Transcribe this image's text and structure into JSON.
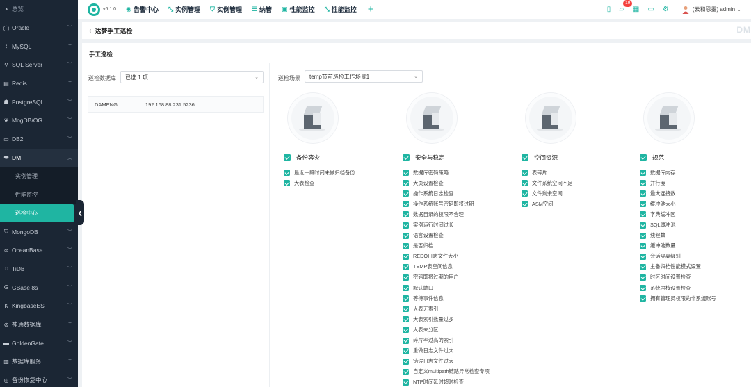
{
  "sidebar": {
    "items": [
      {
        "label": "总览",
        "icon": "overview-icon",
        "glyph": "◔"
      },
      {
        "label": "Oracle",
        "icon": "oracle-icon",
        "glyph": "◯"
      },
      {
        "label": "MySQL",
        "icon": "mysql-icon",
        "glyph": "⌇"
      },
      {
        "label": "SQL Server",
        "icon": "sqlserver-icon",
        "glyph": "⚲"
      },
      {
        "label": "Redis",
        "icon": "redis-icon",
        "glyph": "▤"
      },
      {
        "label": "PostgreSQL",
        "icon": "postgresql-icon",
        "glyph": "☗"
      },
      {
        "label": "MogDB/OG",
        "icon": "mogdb-icon",
        "glyph": "❦"
      },
      {
        "label": "DB2",
        "icon": "db2-icon",
        "glyph": "▭"
      },
      {
        "label": "DM",
        "icon": "dm-icon",
        "glyph": "⬬"
      }
    ],
    "dm_sub": [
      {
        "label": "实例管理"
      },
      {
        "label": "性能监控"
      },
      {
        "label": "巡检中心"
      }
    ],
    "items_after": [
      {
        "label": "MongoDB",
        "icon": "mongodb-icon",
        "glyph": "⛉"
      },
      {
        "label": "OceanBase",
        "icon": "oceanbase-icon",
        "glyph": "∞"
      },
      {
        "label": "TiDB",
        "icon": "tidb-icon",
        "glyph": "◌"
      },
      {
        "label": "GBase 8s",
        "icon": "gbase-icon",
        "glyph": "G"
      },
      {
        "label": "KingbaseES",
        "icon": "kingbase-icon",
        "glyph": "K"
      },
      {
        "label": "神通数据库",
        "icon": "shentong-icon",
        "glyph": "⊛"
      },
      {
        "label": "GoldenGate",
        "icon": "goldengate-icon",
        "glyph": "▬"
      },
      {
        "label": "数据库服务",
        "icon": "db-service-icon",
        "glyph": "▥"
      },
      {
        "label": "备份恢复中心",
        "icon": "backup-icon",
        "glyph": "◎"
      }
    ]
  },
  "topbar": {
    "version": "v6.1.0",
    "nav": [
      {
        "label": "告警中心",
        "icon": "alarm-icon",
        "glyph": "◉"
      },
      {
        "label": "实例管理",
        "icon": "instance-icon",
        "glyph": "⤡"
      },
      {
        "label": "实例管理",
        "icon": "instance-shield-icon",
        "glyph": "⛉"
      },
      {
        "label": "纳管",
        "icon": "manage-icon",
        "glyph": "☰"
      },
      {
        "label": "性能监控",
        "icon": "performance-icon",
        "glyph": "▣"
      },
      {
        "label": "性能监控",
        "icon": "performance-pin-icon",
        "glyph": "⤡"
      }
    ],
    "plus": "+",
    "badge_count": "19",
    "user": "(云和恩墨) admin",
    "colors": {
      "accent": "#1fb5a2",
      "sidebar": "#1b2634",
      "badge": "#f5413d"
    }
  },
  "page": {
    "title": "达梦手工巡检",
    "watermark": "DM",
    "section_title": "手工巡检"
  },
  "form": {
    "db_label": "巡检数据库",
    "db_value": "已选 1 项",
    "scene_label": "巡检场景",
    "scene_value": "temp节前巡检工作场景1",
    "db_row": {
      "name": "DAMENG",
      "ip": "192.168.88.231:5236"
    }
  },
  "categories": [
    {
      "title": "备份容灾",
      "icon": "backup-cube-icon",
      "items": [
        "最近一段时间未做归档备份",
        "大表检查"
      ]
    },
    {
      "title": "安全与稳定",
      "icon": "security-cube-icon",
      "items": [
        "数据库密码策略",
        "大页设置检查",
        "操作系统日志检查",
        "操作系统账号密码即将过期",
        "数据目录的权限不合理",
        "实例运行时间过长",
        "语言设置检查",
        "是否归档",
        "REDO日志文件大小",
        "TEMP表空间信息",
        "密码即将过期的用户",
        "默认端口",
        "等待事件信息",
        "大表无索引",
        "大表索引数量过多",
        "大表未分区",
        "碎片率过高的索引",
        "重做日志文件过大",
        "错误日志文件过大",
        "自定义multipath链路异常检查专项",
        "NTP时间延时超时检查"
      ]
    },
    {
      "title": "空间资源",
      "icon": "space-cube-icon",
      "items": [
        "表碎片",
        "文件系统空间不足",
        "文件剩余空间",
        "ASM空间"
      ]
    },
    {
      "title": "规范",
      "icon": "standard-cube-icon",
      "items": [
        "数据库内存",
        "并行度",
        "最大连接数",
        "缓冲池大小",
        "字典缓冲区",
        "SQL缓冲池",
        "线程数",
        "缓冲池数量",
        "会话隔离级别",
        "主备归档性能模式设置",
        "时区时间设置检查",
        "系统内核设置检查",
        "拥有管理员权限的非系统账号"
      ]
    }
  ]
}
